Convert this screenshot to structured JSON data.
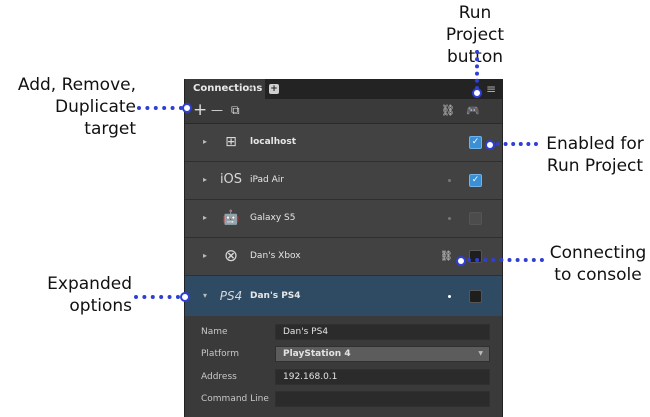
{
  "panel": {
    "tab_label": "Connections",
    "tab_close": "×",
    "tab_add": "+",
    "menu": "≡",
    "toolbar": {
      "add": "+",
      "remove": "—",
      "duplicate": "⧉",
      "link": "⛓",
      "gamepad": "🎮"
    },
    "rows": [
      {
        "os": "windows-icon",
        "os_text": "⊞",
        "name": "localhost",
        "status": "",
        "enabled": true
      },
      {
        "os": "ios-icon",
        "os_text": "iOS",
        "name": "iPad Air",
        "status": "•",
        "enabled": true
      },
      {
        "os": "android-icon",
        "os_text": "🤖",
        "name": "Galaxy S5",
        "status": "•",
        "enabled": false
      },
      {
        "os": "xbox-icon",
        "os_text": "⊗",
        "name": "Dan's Xbox",
        "status": "⛓",
        "enabled": false
      },
      {
        "os": "ps4-icon",
        "os_text": "PS4",
        "name": "Dan's PS4",
        "status": "•",
        "enabled": false
      }
    ],
    "options": {
      "name_label": "Name",
      "name_value": "Dan's PS4",
      "platform_label": "Platform",
      "platform_value": "PlayStation 4",
      "address_label": "Address",
      "address_value": "192.168.0.1",
      "command_label": "Command Line",
      "command_value": ""
    }
  },
  "annotations": {
    "run_project_l1": "Run Project",
    "run_project_l2": "button",
    "add_remove_l1": "Add, Remove,",
    "add_remove_l2": "Duplicate target",
    "enabled_l1": "Enabled for",
    "enabled_l2": "Run Project",
    "connecting_l1": "Connecting",
    "connecting_l2": "to console",
    "expanded_l1": "Expanded",
    "expanded_l2": "options"
  },
  "colors": {
    "accent": "#2f3fd6",
    "panel_bg": "#3a3a3a",
    "selected_row": "#2f4a63",
    "checkbox_on": "#3b8fd4"
  }
}
